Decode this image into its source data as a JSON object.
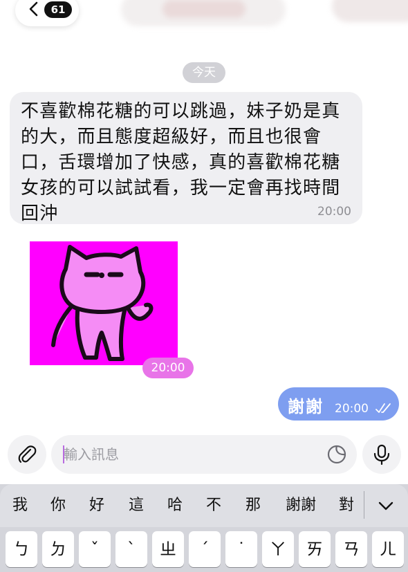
{
  "header": {
    "back_label": "<",
    "unread_count": "61"
  },
  "date_chip": "今天",
  "messages": {
    "incoming_text": "不喜歡棉花糖的可以跳過，妹子奶是真的大，而且態度超級好，而且也很會口，舌環增加了快感，真的喜歡棉花糖女孩的可以試試看，我一定會再找時間回沖",
    "incoming_time": "20:00",
    "sticker_time": "20:00",
    "outgoing_text": "謝謝",
    "outgoing_time": "20:00"
  },
  "composer": {
    "placeholder": "輸入訊息",
    "icons": [
      "paperclip-icon",
      "sticker-icon",
      "microphone-icon"
    ]
  },
  "keyboard": {
    "candidates": [
      "我",
      "你",
      "好",
      "這",
      "哈",
      "不",
      "那",
      "謝謝",
      "對"
    ],
    "keys": [
      "ㄅ",
      "ㄉ",
      "ˇ",
      "ˋ",
      "ㄓ",
      "ˊ",
      "˙",
      "ㄚ",
      "ㄞ",
      "ㄢ",
      "ㄦ"
    ]
  },
  "colors": {
    "incoming_bubble": "#efeff2",
    "outgoing_bubble": "#7e9ef0",
    "sticker_bg": "#ff00ff",
    "sticker_time_chip": "#e874e8",
    "date_chip": "#d1d1d6",
    "keyboard_bg": "#d4d5db"
  }
}
